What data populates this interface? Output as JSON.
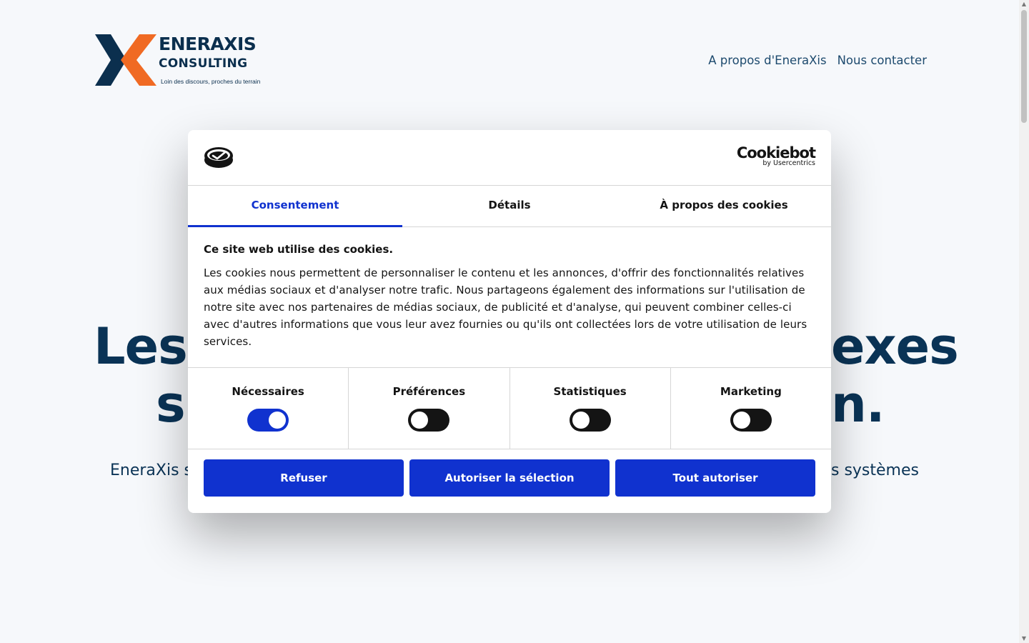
{
  "site": {
    "logo": {
      "name": "ENERAXIS",
      "subtitle": "CONSULTING",
      "tagline": "Loin des discours, proches du terrain",
      "colors": {
        "navy": "#0b2f4e",
        "orange": "#f06a23"
      }
    },
    "nav": [
      {
        "label": "A propos d'EneraXis"
      },
      {
        "label": "Nous contacter"
      }
    ],
    "hero": {
      "line1_left": "Les",
      "line1_right": "exes",
      "line2_left": "s",
      "line2_right": "n.",
      "sub_left": "EneraXis s",
      "sub_right": "s systèmes"
    }
  },
  "cookie_dialog": {
    "brand": {
      "name": "Cookiebot",
      "by": "by Usercentrics"
    },
    "tabs": [
      {
        "label": "Consentement",
        "active": true
      },
      {
        "label": "Détails",
        "active": false
      },
      {
        "label": "À propos des cookies",
        "active": false
      }
    ],
    "title": "Ce site web utilise des cookies.",
    "body": "Les cookies nous permettent de personnaliser le contenu et les annonces, d'offrir des fonctionnalités relatives aux médias sociaux et d'analyser notre trafic. Nous partageons également des informations sur l'utilisation de notre site avec nos partenaires de médias sociaux, de publicité et d'analyse, qui peuvent combiner celles-ci avec d'autres informations que vous leur avez fournies ou qu'ils ont collectées lors de votre utilisation de leurs services.",
    "toggles": [
      {
        "label": "Nécessaires",
        "on": true
      },
      {
        "label": "Préférences",
        "on": false
      },
      {
        "label": "Statistiques",
        "on": false
      },
      {
        "label": "Marketing",
        "on": false
      }
    ],
    "buttons": {
      "deny": "Refuser",
      "allow_selection": "Autoriser la sélection",
      "allow_all": "Tout autoriser"
    },
    "colors": {
      "accent": "#1032cf",
      "text": "#141414"
    }
  }
}
